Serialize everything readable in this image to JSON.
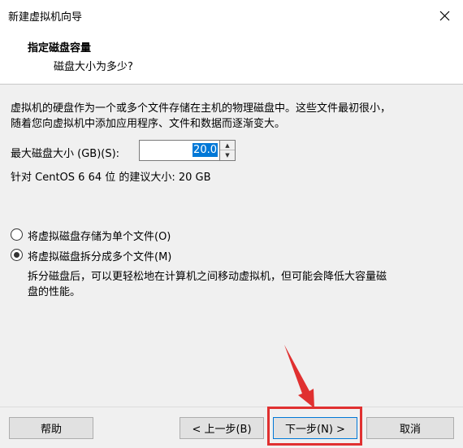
{
  "window": {
    "title": "新建虚拟机向导"
  },
  "header": {
    "title": "指定磁盘容量",
    "subtitle": "磁盘大小为多少?"
  },
  "description": {
    "line1": "虚拟机的硬盘作为一个或多个文件存储在主机的物理磁盘中。这些文件最初很小，",
    "line2": "随着您向虚拟机中添加应用程序、文件和数据而逐渐变大。"
  },
  "disk_size": {
    "label": "最大磁盘大小 (GB)(S):",
    "value": "20.0"
  },
  "recommend": {
    "text": "针对 CentOS 6 64 位 的建议大小: 20 GB"
  },
  "options": {
    "single": {
      "label": "将虚拟磁盘存储为单个文件(O)",
      "checked": false
    },
    "multiple": {
      "label": "将虚拟磁盘拆分成多个文件(M)",
      "checked": true
    },
    "multiple_desc_line1": "拆分磁盘后，可以更轻松地在计算机之间移动虚拟机，但可能会降低大容量磁",
    "multiple_desc_line2": "盘的性能。"
  },
  "footer": {
    "help": "帮助",
    "back": "< 上一步(B)",
    "next": "下一步(N) >",
    "cancel": "取消"
  },
  "annotation": {
    "color": "#e03030"
  }
}
